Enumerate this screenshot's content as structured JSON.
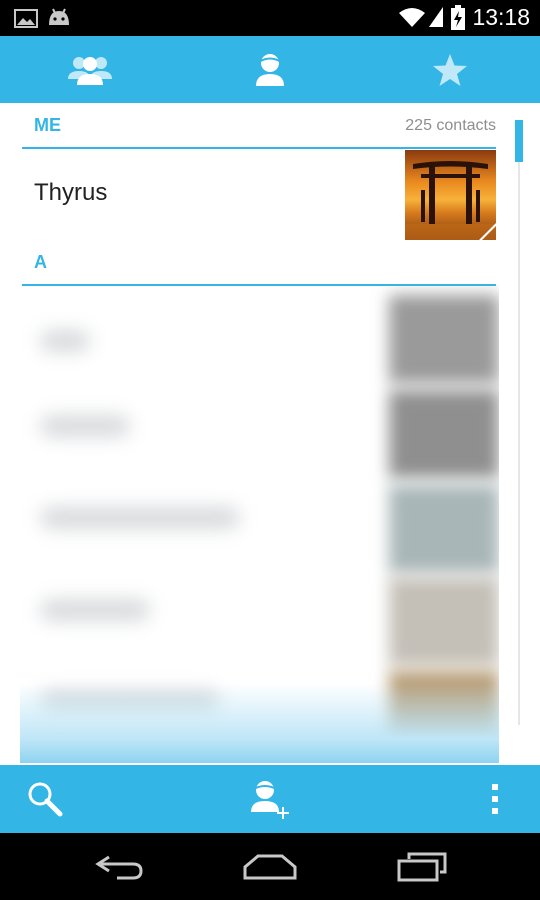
{
  "status_bar": {
    "time": "13:18",
    "icons": [
      "gallery-icon",
      "android-debug-icon",
      "wifi-icon",
      "signal-icon",
      "battery-charging-icon"
    ]
  },
  "tabs": [
    {
      "name": "groups",
      "icon": "groups-icon",
      "selected": false
    },
    {
      "name": "all-contacts",
      "icon": "person-icon",
      "selected": true
    },
    {
      "name": "favorites",
      "icon": "star-icon",
      "selected": false
    }
  ],
  "list": {
    "me_header": {
      "title": "ME",
      "count": "225 contacts"
    },
    "me_contact": {
      "name": "Thyrus",
      "photo": "torii-gate-sunset-photo"
    },
    "section_a": {
      "title": "A"
    }
  },
  "action_bar": {
    "items": [
      {
        "name": "search",
        "icon": "search-icon"
      },
      {
        "name": "add-contact",
        "icon": "add-contact-icon"
      },
      {
        "name": "overflow-menu",
        "icon": "more-vertical-icon"
      }
    ]
  },
  "nav_bar": {
    "items": [
      "back-icon",
      "home-icon",
      "recent-apps-icon"
    ]
  },
  "colors": {
    "accent": "#33b5e5",
    "status_bar": "#000000",
    "nav_bar": "#000000",
    "secondary_text": "#8e8e8e"
  }
}
